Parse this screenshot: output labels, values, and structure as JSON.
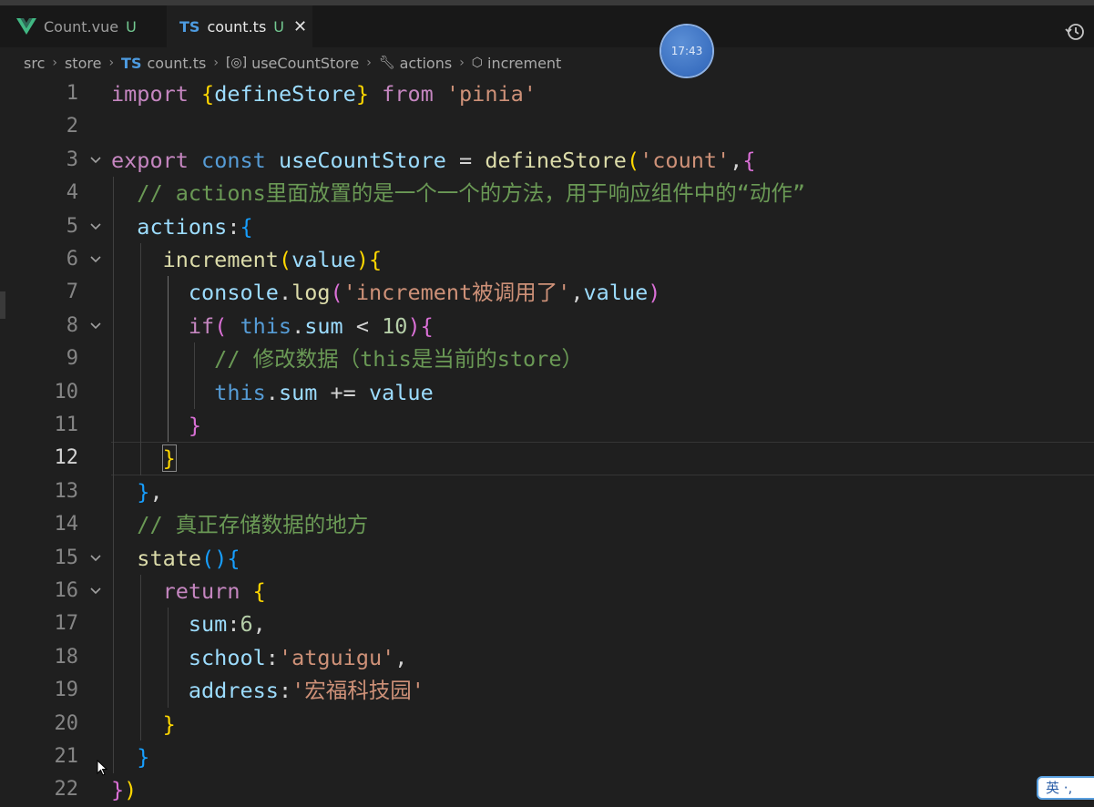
{
  "tabs": [
    {
      "label": "Count.vue",
      "status": "U"
    },
    {
      "label": "count.ts",
      "status": "U",
      "close": "✕",
      "badge": "TS"
    }
  ],
  "breadcrumb": {
    "items": [
      "src",
      "store",
      "count.ts",
      "useCountStore",
      "actions",
      "increment"
    ],
    "ts_badge": "TS",
    "separator": "›"
  },
  "clock": "17:43",
  "ime": "英 ·, ",
  "colors": {
    "keyword": "#c586c0",
    "storage": "#569cd6",
    "function": "#dcdcaa",
    "variable": "#9cdcfe",
    "string": "#ce9178",
    "comment": "#6a9955",
    "number": "#b5cea8"
  },
  "editor": {
    "current_line": 12,
    "lines": [
      {
        "n": "1",
        "parts": [
          [
            "kw",
            "import "
          ],
          [
            "b1",
            "{"
          ],
          [
            "va",
            "defineStore"
          ],
          [
            "b1",
            "}"
          ],
          [
            "kw",
            " from "
          ],
          [
            "str",
            "'pinia'"
          ]
        ]
      },
      {
        "n": "2",
        "parts": []
      },
      {
        "n": "3",
        "fold": true,
        "parts": [
          [
            "kw",
            "export "
          ],
          [
            "st",
            "const "
          ],
          [
            "va",
            "useCountStore"
          ],
          [
            "pl",
            " = "
          ],
          [
            "fn",
            "defineStore"
          ],
          [
            "b1",
            "("
          ],
          [
            "str",
            "'count'"
          ],
          [
            "pl",
            ","
          ],
          [
            "b2",
            "{"
          ]
        ]
      },
      {
        "n": "4",
        "parts": [
          [
            "cm",
            "  // actions里面放置的是一个一个的方法，用于响应组件中的“动作”"
          ]
        ]
      },
      {
        "n": "5",
        "fold": true,
        "parts": [
          [
            "pl",
            "  "
          ],
          [
            "va",
            "actions"
          ],
          [
            "pl",
            ":"
          ],
          [
            "b3",
            "{"
          ]
        ]
      },
      {
        "n": "6",
        "fold": true,
        "parts": [
          [
            "pl",
            "    "
          ],
          [
            "fn",
            "increment"
          ],
          [
            "b1",
            "("
          ],
          [
            "va",
            "value"
          ],
          [
            "b1",
            ")"
          ],
          [
            "b1",
            "{"
          ]
        ]
      },
      {
        "n": "7",
        "parts": [
          [
            "pl",
            "      "
          ],
          [
            "va",
            "console"
          ],
          [
            "pl",
            "."
          ],
          [
            "fn",
            "log"
          ],
          [
            "b2",
            "("
          ],
          [
            "str",
            "'increment被调用了'"
          ],
          [
            "pl",
            ","
          ],
          [
            "va",
            "value"
          ],
          [
            "b2",
            ")"
          ]
        ]
      },
      {
        "n": "8",
        "fold": true,
        "parts": [
          [
            "pl",
            "      "
          ],
          [
            "kw",
            "if"
          ],
          [
            "b2",
            "("
          ],
          [
            "st",
            " this"
          ],
          [
            "pl",
            "."
          ],
          [
            "va",
            "sum"
          ],
          [
            "pl",
            " < "
          ],
          [
            "num",
            "10"
          ],
          [
            "b2",
            ")"
          ],
          [
            "b2",
            "{"
          ]
        ]
      },
      {
        "n": "9",
        "parts": [
          [
            "cm",
            "        // 修改数据（this是当前的store）"
          ]
        ]
      },
      {
        "n": "10",
        "parts": [
          [
            "pl",
            "        "
          ],
          [
            "st",
            "this"
          ],
          [
            "pl",
            "."
          ],
          [
            "va",
            "sum"
          ],
          [
            "pl",
            " += "
          ],
          [
            "va",
            "value"
          ]
        ]
      },
      {
        "n": "11",
        "parts": [
          [
            "pl",
            "      "
          ],
          [
            "b2",
            "}"
          ]
        ]
      },
      {
        "n": "12",
        "parts": [
          [
            "pl",
            "    "
          ],
          [
            "b1",
            "}"
          ]
        ]
      },
      {
        "n": "13",
        "parts": [
          [
            "pl",
            "  "
          ],
          [
            "b3",
            "}"
          ],
          [
            "pl",
            ","
          ]
        ]
      },
      {
        "n": "14",
        "parts": [
          [
            "cm",
            "  // 真正存储数据的地方"
          ]
        ]
      },
      {
        "n": "15",
        "fold": true,
        "parts": [
          [
            "pl",
            "  "
          ],
          [
            "fn",
            "state"
          ],
          [
            "b3",
            "()"
          ],
          [
            "b3",
            "{"
          ]
        ]
      },
      {
        "n": "16",
        "fold": true,
        "parts": [
          [
            "pl",
            "    "
          ],
          [
            "kw",
            "return "
          ],
          [
            "b1",
            "{"
          ]
        ]
      },
      {
        "n": "17",
        "parts": [
          [
            "pl",
            "      "
          ],
          [
            "va",
            "sum"
          ],
          [
            "pl",
            ":"
          ],
          [
            "num",
            "6"
          ],
          [
            "pl",
            ","
          ]
        ]
      },
      {
        "n": "18",
        "parts": [
          [
            "pl",
            "      "
          ],
          [
            "va",
            "school"
          ],
          [
            "pl",
            ":"
          ],
          [
            "str",
            "'atguigu'"
          ],
          [
            "pl",
            ","
          ]
        ]
      },
      {
        "n": "19",
        "parts": [
          [
            "pl",
            "      "
          ],
          [
            "va",
            "address"
          ],
          [
            "pl",
            ":"
          ],
          [
            "str",
            "'宏福科技园'"
          ]
        ]
      },
      {
        "n": "20",
        "parts": [
          [
            "pl",
            "    "
          ],
          [
            "b1",
            "}"
          ]
        ]
      },
      {
        "n": "21",
        "parts": [
          [
            "pl",
            "  "
          ],
          [
            "b3",
            "}"
          ]
        ]
      },
      {
        "n": "22",
        "parts": [
          [
            "b2",
            "}"
          ],
          [
            "b1",
            ")"
          ]
        ]
      }
    ]
  }
}
